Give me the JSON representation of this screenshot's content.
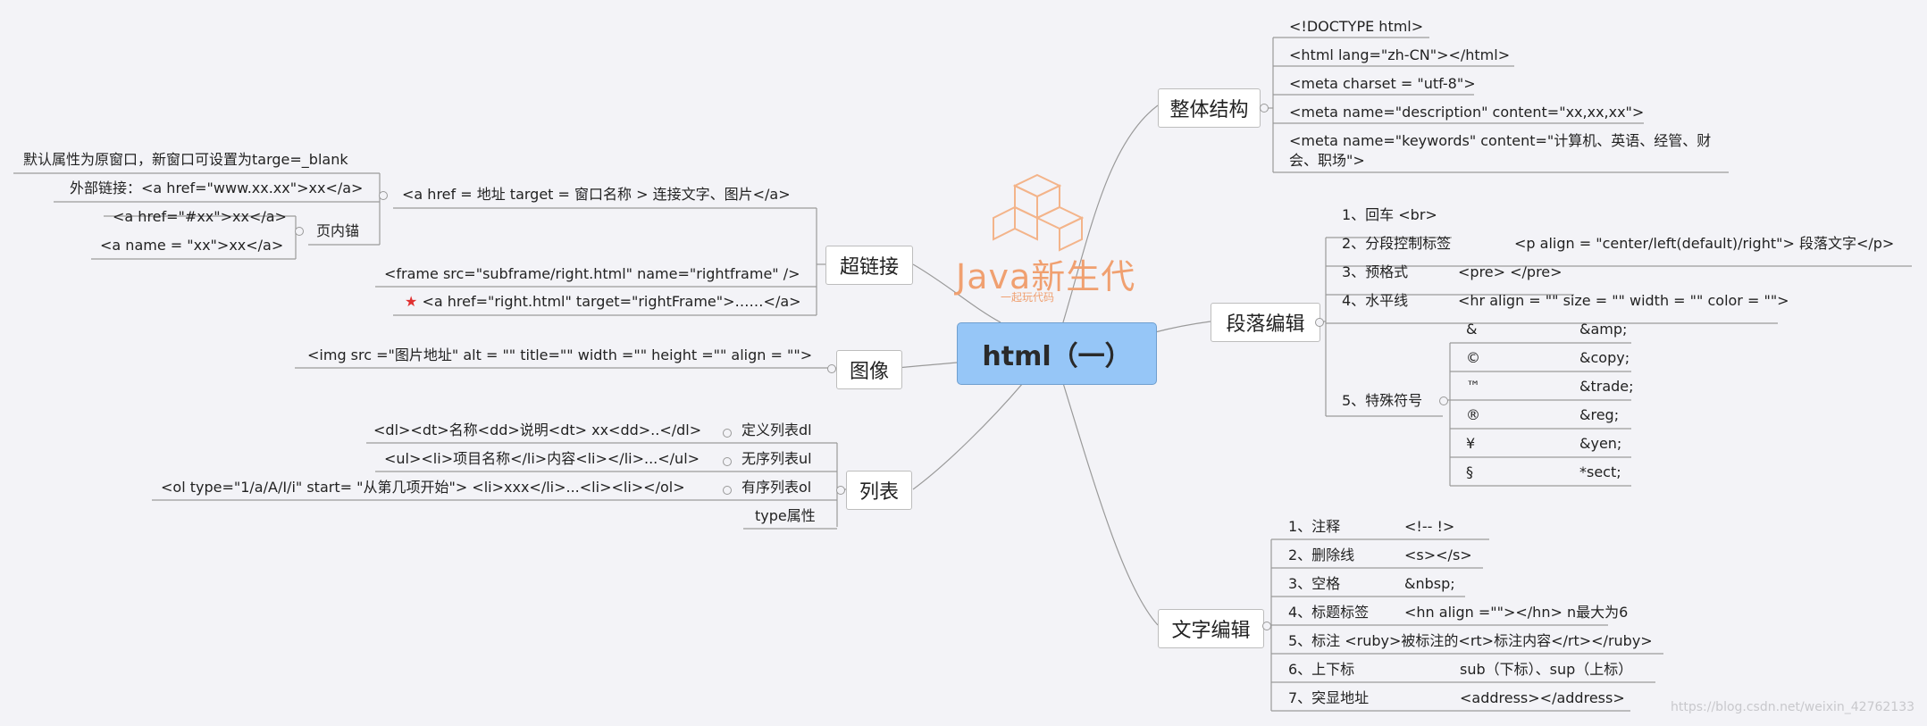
{
  "root": "html（一）",
  "logo": {
    "word": "Java新生代",
    "sub": "一起玩代码"
  },
  "watermark": "https://blog.csdn.net/weixin_42762133",
  "structure": {
    "title": "整体结构",
    "items": [
      "<!DOCTYPE html>",
      "<html lang=\"zh-CN\"></html>",
      "<meta charset = \"utf-8\">",
      "<meta name=\"description\" content=\"xx,xx,xx\">",
      "<meta name=\"keywords\" content=\"计算机、英语、经管、财",
      "会、职场\">"
    ]
  },
  "paragraph": {
    "title": "段落编辑",
    "items": [
      {
        "label": "1、回车 <br>",
        "code": ""
      },
      {
        "label": "2、分段控制标签",
        "code": "<p align = \"center/left(default)/right\"> 段落文字</p>"
      },
      {
        "label": "3、预格式",
        "code": "<pre>  </pre>"
      },
      {
        "label": "4、水平线",
        "code": "<hr align = \"\" size = \"\" width = \"\" color = \"\">"
      },
      {
        "label": "5、特殊符号",
        "code": ""
      }
    ],
    "symbols": [
      {
        "sym": "&",
        "code": "&amp;"
      },
      {
        "sym": "©",
        "code": "&copy;"
      },
      {
        "sym": "™",
        "code": "&trade;"
      },
      {
        "sym": "®",
        "code": "&reg;"
      },
      {
        "sym": "¥",
        "code": "&yen;"
      },
      {
        "sym": "§",
        "code": "*sect;"
      }
    ]
  },
  "text": {
    "title": "文字编辑",
    "items": [
      {
        "label": "1、注释",
        "code": "<!--      !>"
      },
      {
        "label": "2、删除线",
        "code": "<s></s>"
      },
      {
        "label": "3、空格",
        "code": "&nbsp;"
      },
      {
        "label": "4、标题标签",
        "code": "<hn align =\"\"></hn>  n最大为6"
      },
      {
        "label": "5、标注 <ruby>被标注的<rt>标注内容</rt></ruby>",
        "code": ""
      },
      {
        "label": "6、上下标",
        "code": "sub（下标）、sup（上标）"
      },
      {
        "label": "7、突显地址",
        "code": "<address></address>"
      }
    ]
  },
  "hyperlink": {
    "title": "超链接",
    "anchor": "<a href = 地址 target = 窗口名称 > 连接文字、图片</a>",
    "default_attr": "默认属性为原窗口，新窗口可设置为targe=_blank",
    "external": "外部链接：<a href=\"www.xx.xx\">xx</a>",
    "inner_title": "页内锚",
    "inner_1": "<a href=\"#xx\">xx</a>",
    "inner_2": "<a name = \"xx\">xx</a>",
    "frame": "<frame src=\"subframe/right.html\" name=\"rightframe\" />",
    "target": "<a href=\"right.html\"  target=\"rightFrame\">……</a>"
  },
  "image": {
    "title": "图像",
    "code": "<img src =\"图片地址\" alt = \"\" title=\"\" width =\"\" height =\"\" align = \"\">"
  },
  "list": {
    "title": "列表",
    "items": [
      {
        "code": "<dl><dt>名称<dd>说明<dt> xx<dd>..</dl>",
        "label": "定义列表dl"
      },
      {
        "code": "<ul><li>项目名称</li>内容<li></li>...</ul>",
        "label": "无序列表ul"
      },
      {
        "code": "<ol type=\"1/a/A/Ⅰ/i\" start= \"从第几项开始\"> <li>xxx</li>...<li><li></ol>",
        "label": "有序列表ol"
      },
      {
        "code": "",
        "label": "type属性"
      }
    ]
  }
}
